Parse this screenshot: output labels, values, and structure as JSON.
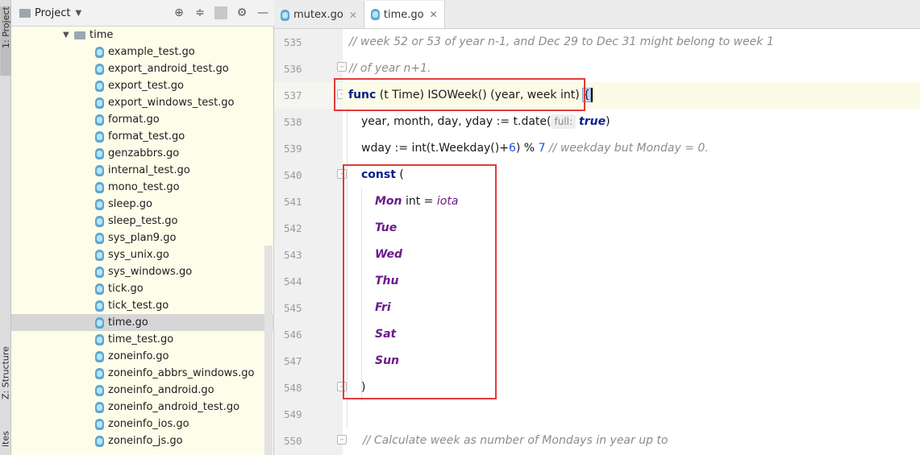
{
  "toolstrip": {
    "project_tab": "1: Project",
    "structure_tab": "Z: Structure",
    "favorites_tab": "ites"
  },
  "project_panel": {
    "title": "Project",
    "tools": [
      "locate-icon",
      "collapse-icon",
      "settings-icon",
      "hide-icon"
    ],
    "folder": "time",
    "files": [
      "example_test.go",
      "export_android_test.go",
      "export_test.go",
      "export_windows_test.go",
      "format.go",
      "format_test.go",
      "genzabbrs.go",
      "internal_test.go",
      "mono_test.go",
      "sleep.go",
      "sleep_test.go",
      "sys_plan9.go",
      "sys_unix.go",
      "sys_windows.go",
      "tick.go",
      "tick_test.go",
      "time.go",
      "time_test.go",
      "zoneinfo.go",
      "zoneinfo_abbrs_windows.go",
      "zoneinfo_android.go",
      "zoneinfo_android_test.go",
      "zoneinfo_ios.go",
      "zoneinfo_js.go"
    ],
    "selected_file": "time.go"
  },
  "tabs": [
    {
      "label": "mutex.go",
      "active": false
    },
    {
      "label": "time.go",
      "active": true
    }
  ],
  "editor": {
    "line_numbers": [
      "535",
      "536",
      "537",
      "538",
      "539",
      "540",
      "541",
      "542",
      "543",
      "544",
      "545",
      "546",
      "547",
      "548",
      "549",
      "550"
    ],
    "current_line": "537",
    "code": {
      "l535_comment": "// week 52 or 53 of year n-1, and Dec 29 to Dec 31 might belong to week 1",
      "l536_comment": "// of year n+1.",
      "l537_func": "func",
      "l537_rest": " (t Time) ISOWeek() (year, week int) ",
      "l537_brace": "{",
      "l538_code": "year, month, day, yday := t.date(",
      "l538_hint": "full:",
      "l538_true": "true",
      "l538_close": ")",
      "l539_code_a": "wday := int(t.Weekday()+",
      "l539_num_a": "6",
      "l539_code_b": ") % ",
      "l539_num_b": "7",
      "l539_comment": " // weekday but Monday = 0.",
      "l540_const": "const",
      "l540_paren": " (",
      "l541_mon": "Mon",
      "l541_rest": " int = ",
      "l541_iota": "iota",
      "days": [
        "Tue",
        "Wed",
        "Thu",
        "Fri",
        "Sat",
        "Sun"
      ],
      "l548_close": ")",
      "l550_comment": "// Calculate week as number of Mondays in year up to"
    }
  },
  "colors": {
    "highlight_box": "#e03c3c",
    "project_bg": "#fefdea",
    "keyword": "#0a1e8c",
    "constant": "#6b1a8a",
    "comment": "#8c8c8c"
  }
}
